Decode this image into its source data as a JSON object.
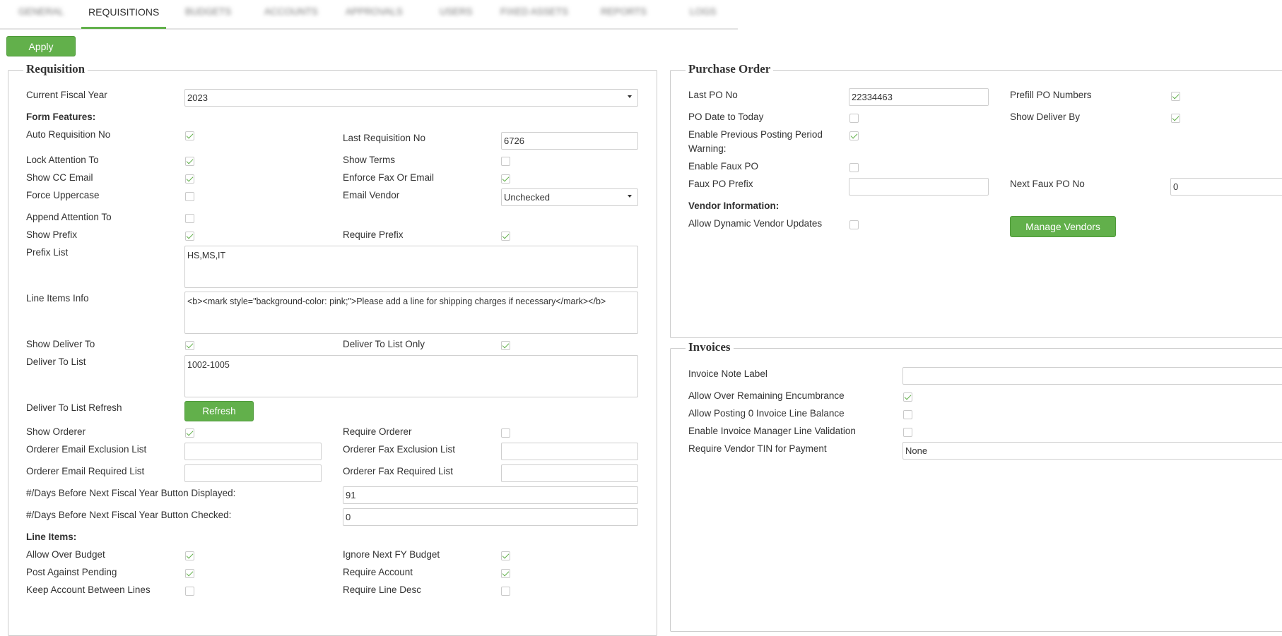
{
  "tabs": [
    {
      "label": "GENERAL",
      "blurred": true
    },
    {
      "label": "REQUISITIONS",
      "blurred": false
    },
    {
      "label": "BUDGETS",
      "blurred": true
    },
    {
      "label": "ACCOUNTS",
      "blurred": true
    },
    {
      "label": "APPROVALS",
      "blurred": true
    },
    {
      "label": "USERS",
      "blurred": true
    },
    {
      "label": "FIXED ASSETS",
      "blurred": true
    },
    {
      "label": "REPORTS",
      "blurred": true
    },
    {
      "label": "LOGS",
      "blurred": true
    }
  ],
  "toolbar": {
    "apply_label": "Apply"
  },
  "requisition": {
    "legend": "Requisition",
    "current_fiscal_year": {
      "label": "Current Fiscal Year",
      "value": "2023"
    },
    "form_features_header": "Form Features:",
    "auto_req_no": {
      "label": "Auto Requisition No",
      "checked": true
    },
    "last_req_no": {
      "label": "Last Requisition No",
      "value": "6726"
    },
    "lock_attention": {
      "label": "Lock Attention To",
      "checked": true
    },
    "show_terms": {
      "label": "Show Terms",
      "checked": false
    },
    "show_cc_email": {
      "label": "Show CC Email",
      "checked": true
    },
    "enforce_fax": {
      "label": "Enforce Fax Or Email",
      "checked": true
    },
    "force_upper": {
      "label": "Force Uppercase",
      "checked": false
    },
    "email_vendor": {
      "label": "Email Vendor",
      "value": "Unchecked"
    },
    "append_attention": {
      "label": "Append Attention To",
      "checked": false
    },
    "show_prefix": {
      "label": "Show Prefix",
      "checked": true
    },
    "require_prefix": {
      "label": "Require Prefix",
      "checked": true
    },
    "prefix_list": {
      "label": "Prefix List",
      "value": "HS,MS,IT"
    },
    "line_items_info": {
      "label": "Line Items Info",
      "value": "<b><mark style=\"background-color: pink;\">Please add a line for shipping charges if necessary</mark></b>"
    },
    "show_deliver_to": {
      "label": "Show Deliver To",
      "checked": true
    },
    "deliver_list_only": {
      "label": "Deliver To List Only",
      "checked": true
    },
    "deliver_to_list": {
      "label": "Deliver To List",
      "value": "1002-1005"
    },
    "deliver_refresh": {
      "label": "Deliver To List Refresh",
      "button": "Refresh"
    },
    "show_orderer": {
      "label": "Show Orderer",
      "checked": true
    },
    "require_orderer": {
      "label": "Require Orderer",
      "checked": false
    },
    "orderer_email_excl": {
      "label": "Orderer Email Exclusion List",
      "value": ""
    },
    "orderer_fax_excl": {
      "label": "Orderer Fax Exclusion List",
      "value": ""
    },
    "orderer_email_req": {
      "label": "Orderer Email Required List",
      "value": ""
    },
    "orderer_fax_req": {
      "label": "Orderer Fax Required List",
      "value": ""
    },
    "days_displayed": {
      "label": "#/Days Before Next Fiscal Year Button Displayed:",
      "value": "91"
    },
    "days_checked": {
      "label": "#/Days Before Next Fiscal Year Button Checked:",
      "value": "0"
    },
    "line_items_header": "Line Items:",
    "allow_over_budget": {
      "label": "Allow Over Budget",
      "checked": true
    },
    "ignore_next_fy": {
      "label": "Ignore Next FY Budget",
      "checked": true
    },
    "post_against_pending": {
      "label": "Post Against Pending",
      "checked": true
    },
    "require_account": {
      "label": "Require Account",
      "checked": true
    },
    "keep_account": {
      "label": "Keep Account Between Lines",
      "checked": false
    },
    "require_line_desc": {
      "label": "Require Line Desc",
      "checked": false
    }
  },
  "purchase_order": {
    "legend": "Purchase Order",
    "last_po_no": {
      "label": "Last PO No",
      "value": "22334463"
    },
    "prefill_po": {
      "label": "Prefill PO Numbers",
      "checked": true
    },
    "po_date_today": {
      "label": "PO Date to Today",
      "checked": false
    },
    "show_deliver_by": {
      "label": "Show Deliver By",
      "checked": true
    },
    "enable_prev_posting": {
      "label": "Enable Previous Posting Period",
      "label2": "Warning:",
      "checked": true
    },
    "enable_faux_po": {
      "label": "Enable Faux PO",
      "checked": false
    },
    "faux_po_prefix": {
      "label": "Faux PO Prefix",
      "value": ""
    },
    "next_faux_po": {
      "label": "Next Faux PO No",
      "value": "0"
    },
    "vendor_info_header": "Vendor Information:",
    "allow_dynamic_vendor": {
      "label": "Allow Dynamic Vendor Updates",
      "checked": false
    },
    "manage_vendors_label": "Manage Vendors"
  },
  "invoices": {
    "legend": "Invoices",
    "invoice_note_label": {
      "label": "Invoice Note Label",
      "value": ""
    },
    "allow_over_remaining": {
      "label": "Allow Over Remaining Encumbrance",
      "checked": true
    },
    "allow_posting_zero": {
      "label": "Allow Posting 0 Invoice Line Balance",
      "checked": false
    },
    "enable_line_validation": {
      "label": "Enable Invoice Manager Line Validation",
      "checked": false
    },
    "require_vendor_tin": {
      "label": "Require Vendor TIN for Payment",
      "value": "None"
    }
  },
  "colors": {
    "accent": "#62b04b",
    "border": "#cccccc",
    "text": "#333333"
  }
}
